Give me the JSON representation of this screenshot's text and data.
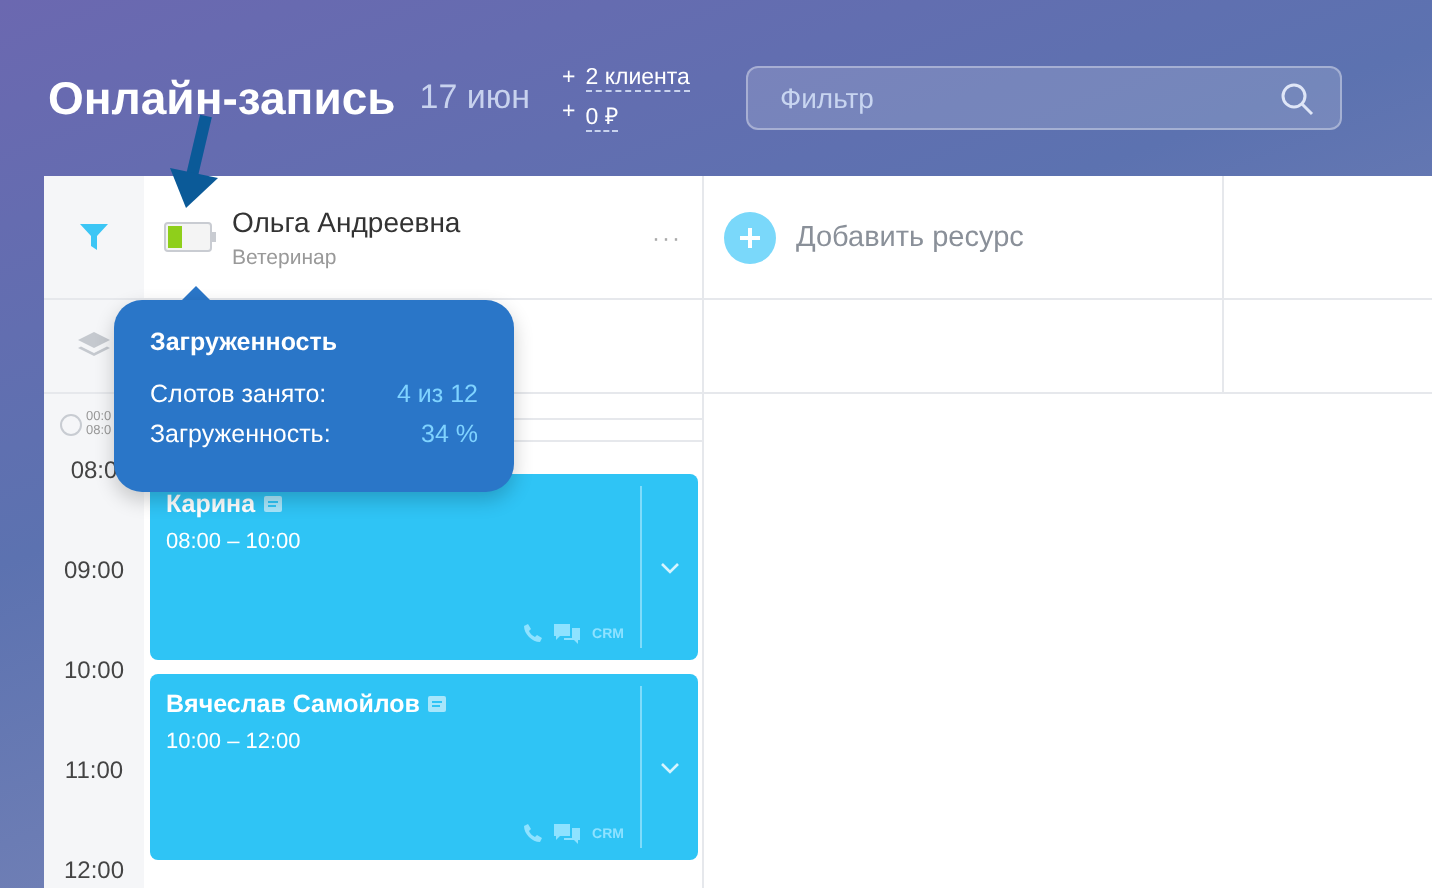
{
  "header": {
    "title": "Онлайн-запись",
    "date": "17 июн",
    "stats": [
      {
        "prefix": "+",
        "value": "2 клиента"
      },
      {
        "prefix": "+",
        "value": "0 ₽"
      }
    ],
    "filter": {
      "placeholder": "Фильтр"
    }
  },
  "resource": {
    "name": "Ольга Андреевна",
    "role": "Ветеринар",
    "more": "···",
    "level": 0.34
  },
  "add_resource": "Добавить ресурс",
  "tooltip": {
    "title": "Загруженность",
    "rows": [
      {
        "label": "Слотов занято:",
        "value": "4 из 12"
      },
      {
        "label": "Загруженность:",
        "value": "34 %"
      }
    ]
  },
  "timeline": {
    "range_labels": [
      "00:0",
      "08:0"
    ],
    "hours": [
      "08:0",
      "09:00",
      "10:00",
      "11:00",
      "12:00"
    ]
  },
  "appointments": [
    {
      "client": "Карина",
      "time": "08:00 – 10:00",
      "has_note": true,
      "crm": "CRM"
    },
    {
      "client": "Вячеслав Самойлов",
      "time": "10:00 – 12:00",
      "has_note": true,
      "crm": "CRM"
    }
  ]
}
